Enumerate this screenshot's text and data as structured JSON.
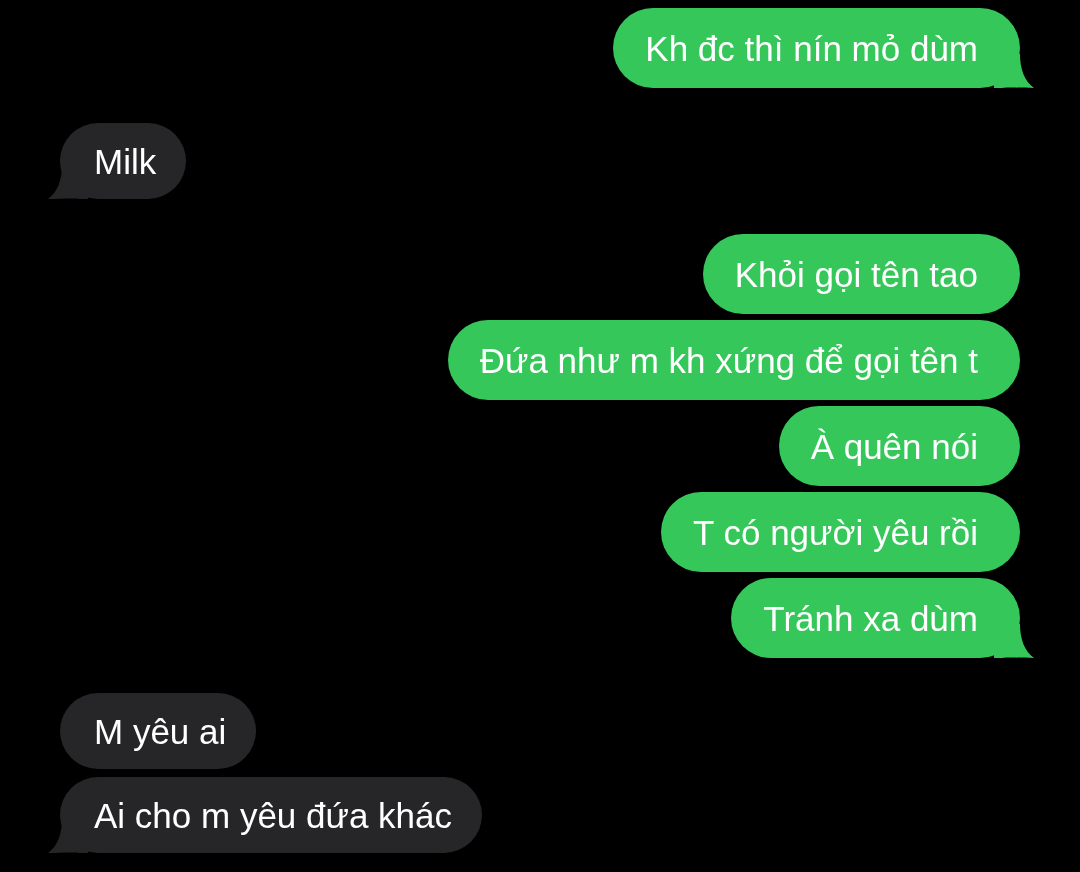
{
  "conversation": [
    {
      "kind": "sent",
      "messages": [
        "Kh đc thì nín mỏ dùm"
      ]
    },
    {
      "kind": "received",
      "messages": [
        "Milk"
      ]
    },
    {
      "kind": "sent",
      "messages": [
        "Khỏi gọi tên tao",
        "Đứa như m kh xứng để gọi tên t",
        "À quên nói",
        "T có người yêu rồi",
        "Tránh xa dùm"
      ]
    },
    {
      "kind": "received",
      "messages": [
        "M yêu ai",
        "Ai cho m yêu đứa khác"
      ]
    }
  ]
}
